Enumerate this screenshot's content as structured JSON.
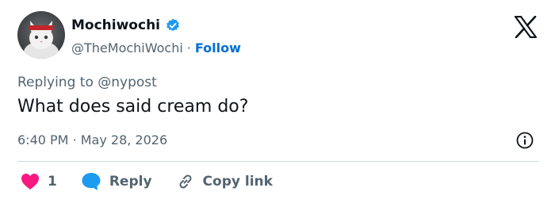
{
  "author": {
    "display_name": "Mochiwochi",
    "handle": "@TheMochiWochi",
    "follow_label": "Follow",
    "separator": "·",
    "avatar_icon": "cat-avatar-icon",
    "verified_icon": "verified-badge-icon"
  },
  "brand": {
    "logo_icon": "x-logo-icon"
  },
  "reply_context": {
    "prefix": "Replying to ",
    "mention": "@nypost"
  },
  "tweet": {
    "text": "What does said cream do?"
  },
  "meta": {
    "timestamp": "6:40 PM · May 28, 2026",
    "info_icon": "info-icon"
  },
  "actions": {
    "like_count": "1",
    "reply_label": "Reply",
    "copy_link_label": "Copy link",
    "like_icon": "heart-icon",
    "reply_icon": "speech-bubble-icon",
    "link_icon": "link-icon"
  },
  "colors": {
    "accent": "#006fd6",
    "verified": "#1d9bf0",
    "like": "#f91880",
    "text": "#0f1419",
    "muted": "#536471"
  }
}
